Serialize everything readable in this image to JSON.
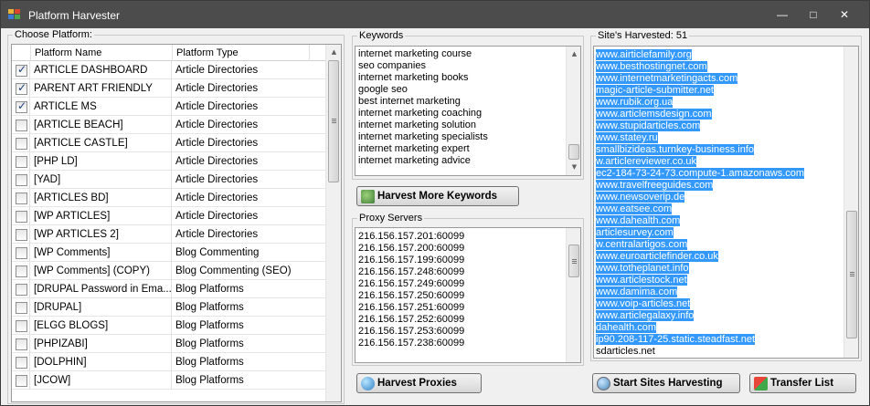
{
  "window": {
    "title": "Platform Harvester",
    "minimize_glyph": "—",
    "maximize_glyph": "□",
    "close_glyph": "✕"
  },
  "platforms": {
    "legend": "Choose Platform:",
    "columns": [
      "Platform Name",
      "Platform Type"
    ],
    "rows": [
      {
        "name": "ARTICLE DASHBOARD",
        "type": "Article Directories",
        "checked": true
      },
      {
        "name": "PARENT ART FRIENDLY",
        "type": "Article Directories",
        "checked": true
      },
      {
        "name": "ARTICLE MS",
        "type": "Article Directories",
        "checked": true
      },
      {
        "name": "[ARTICLE BEACH]",
        "type": "Article Directories",
        "checked": false
      },
      {
        "name": "[ARTICLE CASTLE]",
        "type": "Article Directories",
        "checked": false
      },
      {
        "name": "[PHP LD]",
        "type": "Article Directories",
        "checked": false
      },
      {
        "name": "[YAD]",
        "type": "Article Directories",
        "checked": false
      },
      {
        "name": "[ARTICLES BD]",
        "type": "Article Directories",
        "checked": false
      },
      {
        "name": "[WP ARTICLES]",
        "type": "Article Directories",
        "checked": false
      },
      {
        "name": "[WP ARTICLES 2]",
        "type": "Article Directories",
        "checked": false
      },
      {
        "name": "[WP Comments]",
        "type": "Blog Commenting",
        "checked": false
      },
      {
        "name": "[WP Comments] (COPY)",
        "type": "Blog Commenting (SEO)",
        "checked": false
      },
      {
        "name": "[DRUPAL Password in Ema...",
        "type": "Blog Platforms",
        "checked": false
      },
      {
        "name": "[DRUPAL]",
        "type": "Blog Platforms",
        "checked": false
      },
      {
        "name": "[ELGG BLOGS]",
        "type": "Blog Platforms",
        "checked": false
      },
      {
        "name": "[PHPIZABI]",
        "type": "Blog Platforms",
        "checked": false
      },
      {
        "name": "[DOLPHIN]",
        "type": "Blog Platforms",
        "checked": false
      },
      {
        "name": "[JCOW]",
        "type": "Blog Platforms",
        "checked": false
      }
    ]
  },
  "keywords": {
    "legend": "Keywords",
    "lines": [
      "internet marketing course",
      "seo companies",
      "internet marketing books",
      "google seo",
      "best internet marketing",
      "internet marketing coaching",
      "internet marketing solution",
      "internet marketing specialists",
      "internet marketing expert",
      "internet marketing advice"
    ]
  },
  "harvest_keywords_button": {
    "label": "Harvest More Keywords",
    "icon": "keywords-icon"
  },
  "proxies": {
    "legend": "Proxy Servers",
    "lines": [
      "216.156.157.201:60099",
      "216.156.157.200:60099",
      "216.156.157.199:60099",
      "216.156.157.248:60099",
      "216.156.157.249:60099",
      "216.156.157.250:60099",
      "216.156.157.251:60099",
      "216.156.157.252:60099",
      "216.156.157.253:60099",
      "216.156.157.238:60099"
    ]
  },
  "harvest_proxies_button": {
    "label": "Harvest Proxies",
    "icon": "globe-icon"
  },
  "sites": {
    "legend": "Site's Harvested: 51",
    "lines": [
      "www.airticlefamily.org",
      "www.besthostingnet.com",
      "www.internetmarketingacts.com",
      "magic-article-submitter.net",
      "www.rubik.org.ua",
      "www.articlemsdesign.com",
      "www.stupidarticles.com",
      "www.statey.ru",
      "smallbizideas.turnkey-business.info",
      "w.articlereviewer.co.uk",
      "ec2-184-73-24-73.compute-1.amazonaws.com",
      "www.travelfreeguides.com",
      "www.newsoverip.de",
      "www.eatsee.com",
      "www.dahealth.com",
      "articlesurvey.com",
      "w.centralartigos.com",
      "www.euroarticlefinder.co.uk",
      "www.totheplanet.info",
      "www.articlestock.net",
      "www.damima.com",
      "www.voip-articles.net",
      "www.articlegalaxy.info",
      "dahealth.com",
      "ip90.208-117-25.static.steadfast.net",
      "sdarticles.net"
    ],
    "selected_count": 25
  },
  "start_button": {
    "label": "Start Sites Harvesting",
    "icon": "gear-globe-icon"
  },
  "transfer_button": {
    "label": "Transfer List",
    "icon": "transfer-icon"
  },
  "colors": {
    "titlebar": "#4c4c4c",
    "selection": "#3399ff",
    "window_bg": "#f0f0f0"
  }
}
